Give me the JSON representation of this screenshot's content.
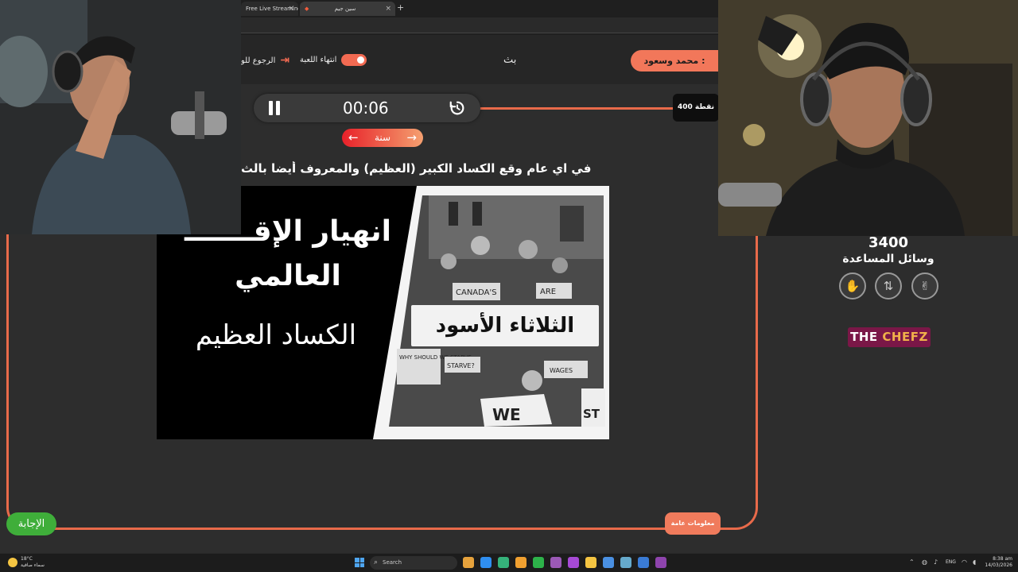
{
  "browser": {
    "tabs": [
      {
        "label": "Free Live Streaming",
        "close": "×"
      },
      {
        "label": "سين جيم",
        "close": "×"
      }
    ],
    "new_tab": "+"
  },
  "header": {
    "player_name": ": محمد وسعود",
    "mode_label": "بث",
    "end_game_label": "انتهاء اللعبة",
    "back_label": "الرجوع للو"
  },
  "timer": {
    "time": "00:06"
  },
  "points_badge": "400 نقطة",
  "year_pill": "سنة",
  "question": "في اي عام وقع الكساد الكبير (العظيم) والمعروف أيضا بالث",
  "image": {
    "title": "انهيار الإقـــــــ العالمي",
    "subtitle": "الكساد العظيم",
    "overlay_label": "الثلاثاء الأسود",
    "signs": [
      "CANADA'S",
      "ARE",
      "WHY SHOULD WE STARVE",
      "STARVE?",
      "WAGES",
      "WE",
      "ST"
    ]
  },
  "side_panel": {
    "score": "3400",
    "helpers_label": "وسائل المساعدة",
    "helpers": [
      {
        "icon": "hand-icon",
        "glyph": "✋"
      },
      {
        "icon": "swap-icon",
        "glyph": "⇅"
      },
      {
        "icon": "two-fingers-icon",
        "glyph": "✌"
      }
    ],
    "brand_left": "THE",
    "brand_right": "CHEFZ"
  },
  "answer_button": "الإجابة",
  "category_button": "معلومات عامة",
  "taskbar": {
    "weather_temp": "18°C",
    "weather_desc": "سماء صافية",
    "search": "Search",
    "lang": "ENG",
    "time": "8:38 am",
    "date": "14/03/2026",
    "app_colors": [
      "#e6a23c",
      "#2f8ef0",
      "#35b27a",
      "#f0a030",
      "#2db34a",
      "#9b59b6",
      "#a74ad6",
      "#f5c542",
      "#4a90e2",
      "#6ac",
      "#3a7bd5",
      "#8e44ad"
    ]
  },
  "colors": {
    "accent": "#e86a4a",
    "answer_green": "#3fae3a",
    "brand_bg": "#7a1747"
  }
}
